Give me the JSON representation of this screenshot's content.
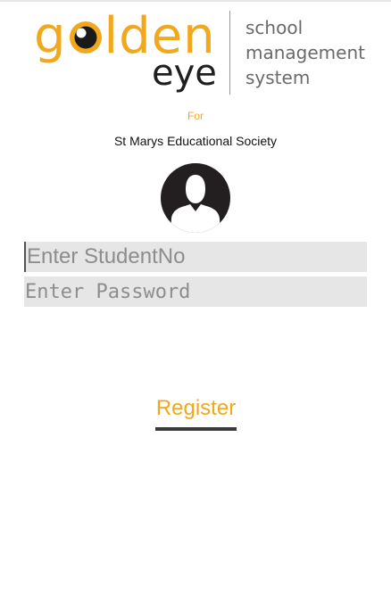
{
  "logo": {
    "word_g": "g",
    "word_rest": "lden",
    "word_sub": "eye",
    "tagline": [
      "school",
      "management",
      "system"
    ]
  },
  "for_label": "For",
  "society_name": "St Marys Educational Society",
  "avatar": {
    "icon": "user-avatar-icon"
  },
  "form": {
    "student_no_placeholder": "Enter StudentNo",
    "student_no_value": "",
    "password_placeholder": "Enter Password",
    "password_value": ""
  },
  "register_label": "Register",
  "colors": {
    "accent": "#f2a81d",
    "field_bg": "#e6e6e6",
    "placeholder": "#8d8d8d",
    "avatar": "#231f20"
  }
}
